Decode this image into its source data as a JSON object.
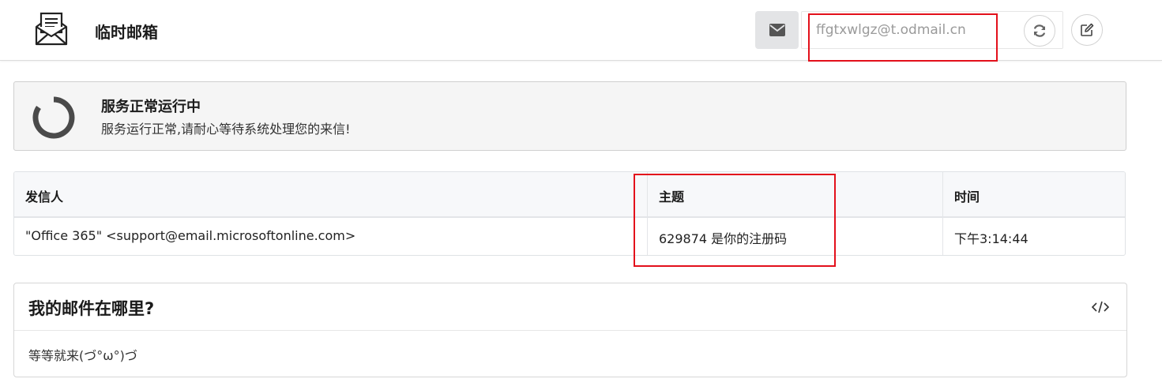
{
  "header": {
    "brand": "临时邮箱",
    "email_value": "ffgtxwlgz@t.odmail.cn"
  },
  "status": {
    "title": "服务正常运行中",
    "description": "服务运行正常,请耐心等待系统处理您的来信!"
  },
  "table": {
    "columns": [
      "发信人",
      "主题",
      "时间"
    ],
    "rows": [
      {
        "sender": "\"Office 365\" <support@email.microsoftonline.com>",
        "subject": "629874 是你的注册码",
        "time": "下午3:14:44"
      }
    ]
  },
  "faq": {
    "title": "我的邮件在哪里?",
    "body": "等等就来(づ°ω°)づ"
  },
  "icons": {
    "logo": "envelope-letter-icon",
    "mail": "envelope-icon",
    "refresh": "refresh-icon",
    "edit": "edit-icon",
    "spinner": "spinner-icon",
    "code": "code-icon"
  },
  "colors": {
    "highlight": "#e3101b"
  }
}
